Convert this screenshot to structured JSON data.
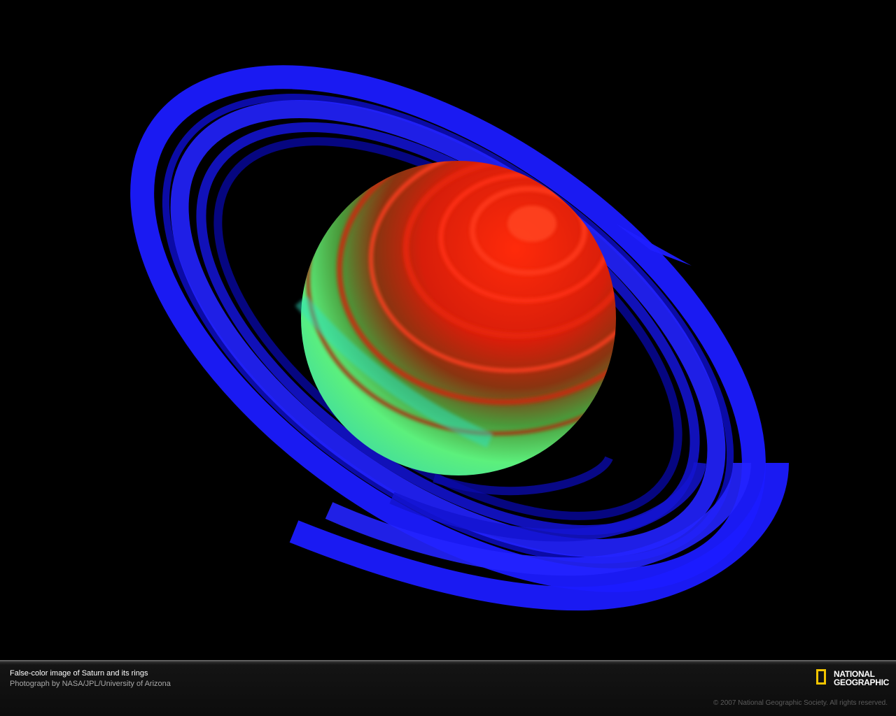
{
  "caption": {
    "title": "False-color image of Saturn and its rings",
    "credit": "Photograph by NASA/JPL/University of Arizona"
  },
  "logo": {
    "line1": "NATIONAL",
    "line2": "GEOGRAPHIC",
    "frame_color": "#f2c400"
  },
  "copyright": "© 2007 National Geographic Society. All rights reserved.",
  "colors": {
    "background": "#000000",
    "rings": "#1a1aff",
    "planet_north": "#e0200c",
    "planet_south": "#4cf07a"
  }
}
